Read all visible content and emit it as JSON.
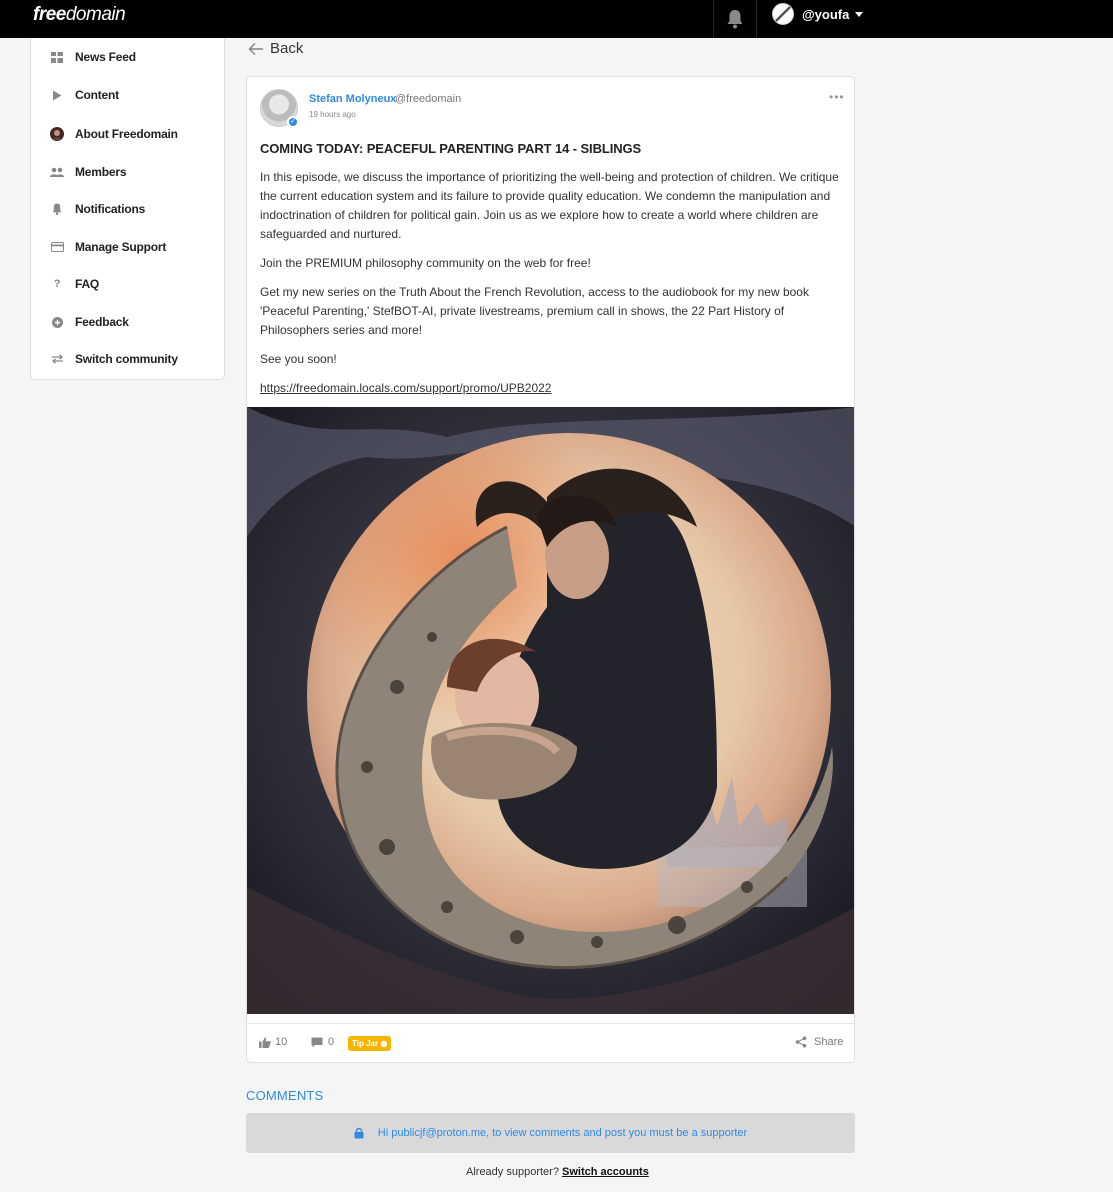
{
  "topbar": {
    "logo_bold": "free",
    "logo_light": "domain",
    "username": "@youfa"
  },
  "sidebar": {
    "items": [
      {
        "label": "News Feed",
        "icon": "grid-icon"
      },
      {
        "label": "Content",
        "icon": "play-icon"
      },
      {
        "label": "About Freedomain",
        "icon": "community-avatar-icon"
      },
      {
        "label": "Members",
        "icon": "users-icon"
      },
      {
        "label": "Notifications",
        "icon": "bell-icon"
      },
      {
        "label": "Manage Support",
        "icon": "credit-card-icon"
      },
      {
        "label": "FAQ",
        "icon": "question-icon"
      },
      {
        "label": "Feedback",
        "icon": "plus-circle-icon"
      },
      {
        "label": "Switch community",
        "icon": "swap-icon"
      }
    ]
  },
  "back_label": "Back",
  "post": {
    "author_name": "Stefan Molyneux",
    "author_handle": "@freedomain",
    "time": "19 hours ago",
    "title": "COMING TODAY: PEACEFUL PARENTING PART 14 - SIBLINGS",
    "paragraphs": [
      "In this episode, we discuss the importance of prioritizing the well-being and protection of children. We critique the current education system and its failure to provide quality education. We condemn the manipulation and indoctrination of children for political gain. Join us as we explore how to create a world where children are safeguarded and nurtured.",
      "Join the PREMIUM philosophy community on the web for free!",
      "Get my new series on the Truth About the French Revolution, access to the audiobook for my new book 'Peaceful Parenting,' StefBOT-AI, private livestreams, premium call in shows, the 22 Part History of Philosophers series and more!",
      "See you soon!"
    ],
    "link": "https://freedomain.locals.com/support/promo/UPB2022",
    "likes": "10",
    "comments": "0",
    "tipjar_label": "Tip Jar",
    "share_label": "Share"
  },
  "comments": {
    "heading": "COMMENTS",
    "locked_message": "Hi publicjf@proton.me, to view comments and post you must be a supporter",
    "already_prefix": "Already supporter?",
    "switch_label": "Switch accounts"
  },
  "colors": {
    "accent": "#2f8ae6",
    "topbar": "#000000",
    "tipjar": "#f7b500"
  }
}
